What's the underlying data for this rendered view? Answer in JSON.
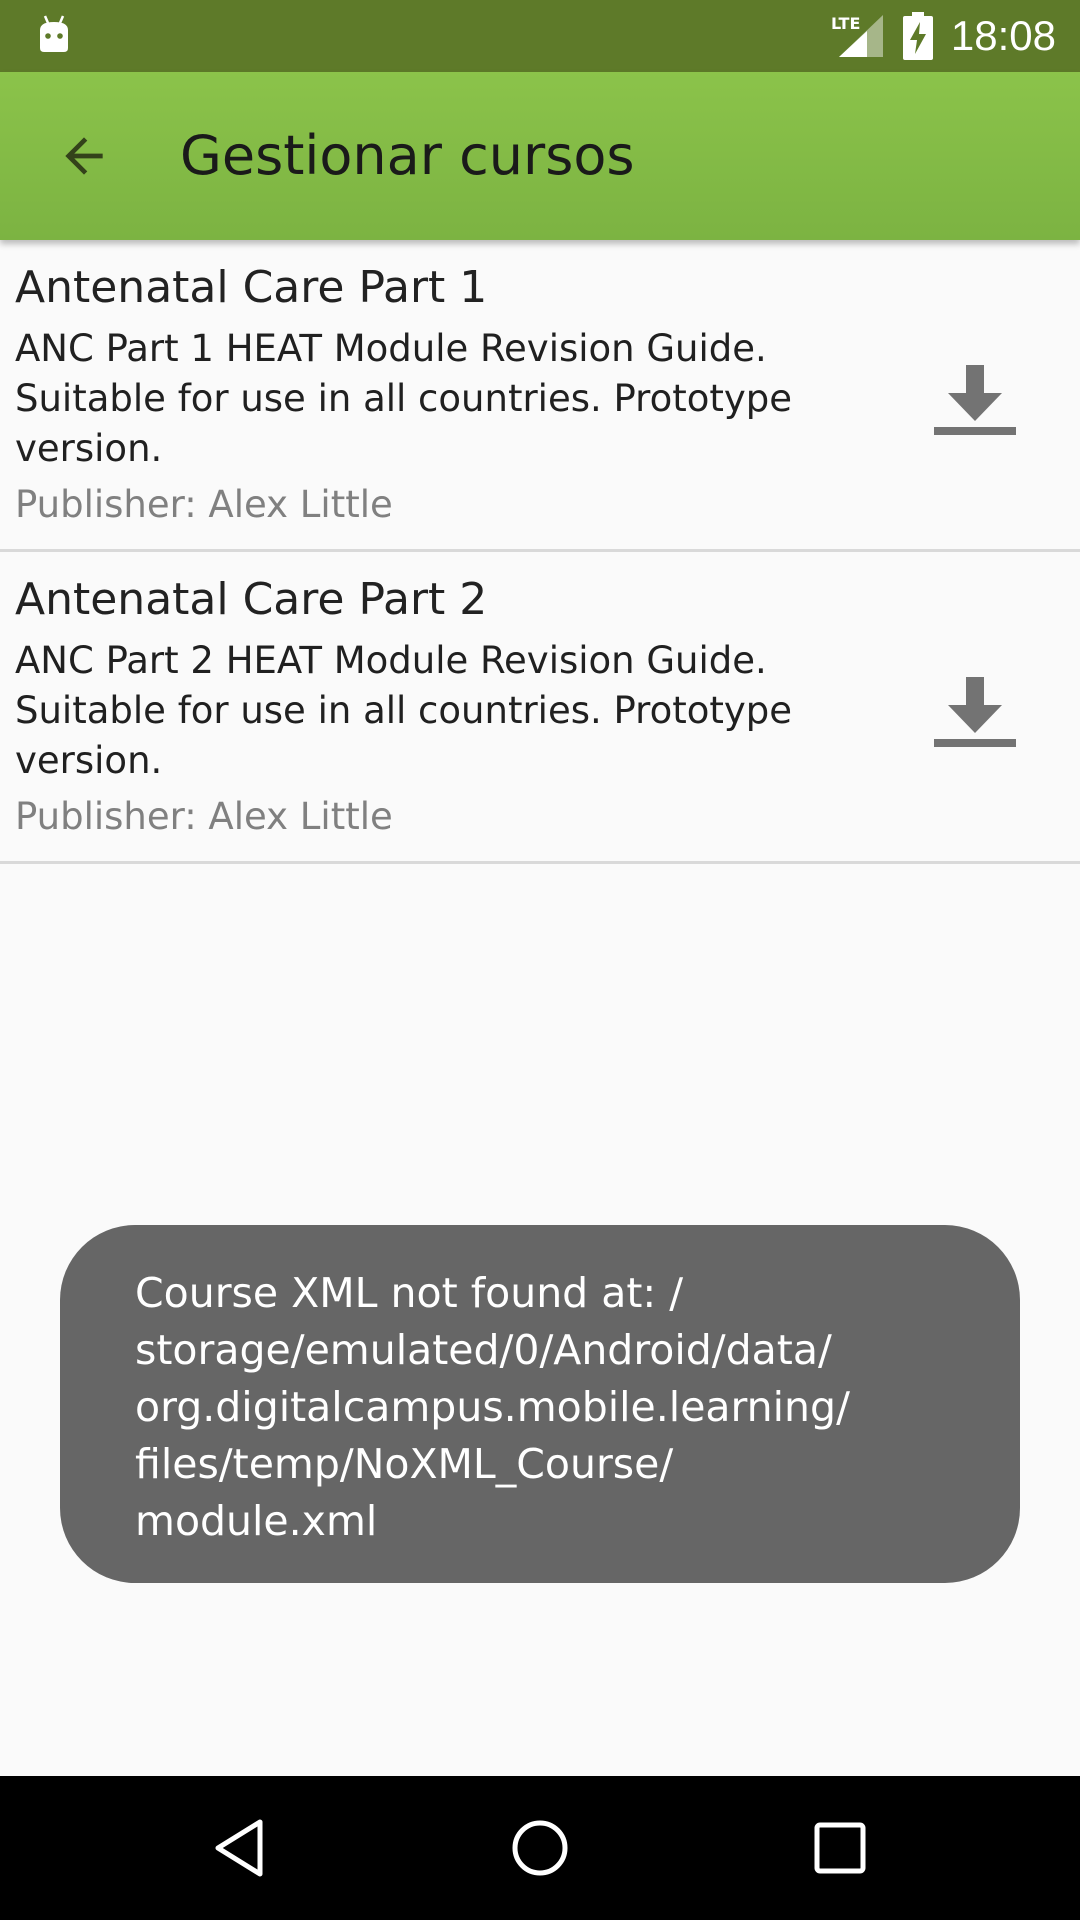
{
  "status_bar": {
    "time": "18:08",
    "network": "LTE",
    "background_color": "#5e7a29"
  },
  "toolbar": {
    "title": "Gestionar cursos",
    "background_color": "#8bc34a",
    "back_icon": "arrow-back-icon"
  },
  "courses": [
    {
      "title": "Antenatal Care Part 1",
      "description_lines": [
        "ANC Part 1 HEAT Module Revision Guide.",
        "Suitable for use in all countries. Prototype",
        "version."
      ],
      "publisher": "Publisher: Alex Little",
      "action_icon": "download-icon"
    },
    {
      "title": "Antenatal Care Part 2",
      "description_lines": [
        "ANC Part 2 HEAT Module Revision Guide.",
        "Suitable for use in all countries. Prototype",
        "version."
      ],
      "publisher": "Publisher: Alex Little",
      "action_icon": "download-icon"
    }
  ],
  "toast": {
    "lines": [
      "Course XML not found at: /",
      "storage/emulated/0/Android/data/",
      "org.digitalcampus.mobile.learning/",
      "files/temp/NoXML_Course/",
      "module.xml"
    ],
    "background_color": "#666666"
  },
  "nav_bar": {
    "back_icon": "nav-back-icon",
    "home_icon": "nav-home-icon",
    "recents_icon": "nav-recents-icon"
  }
}
